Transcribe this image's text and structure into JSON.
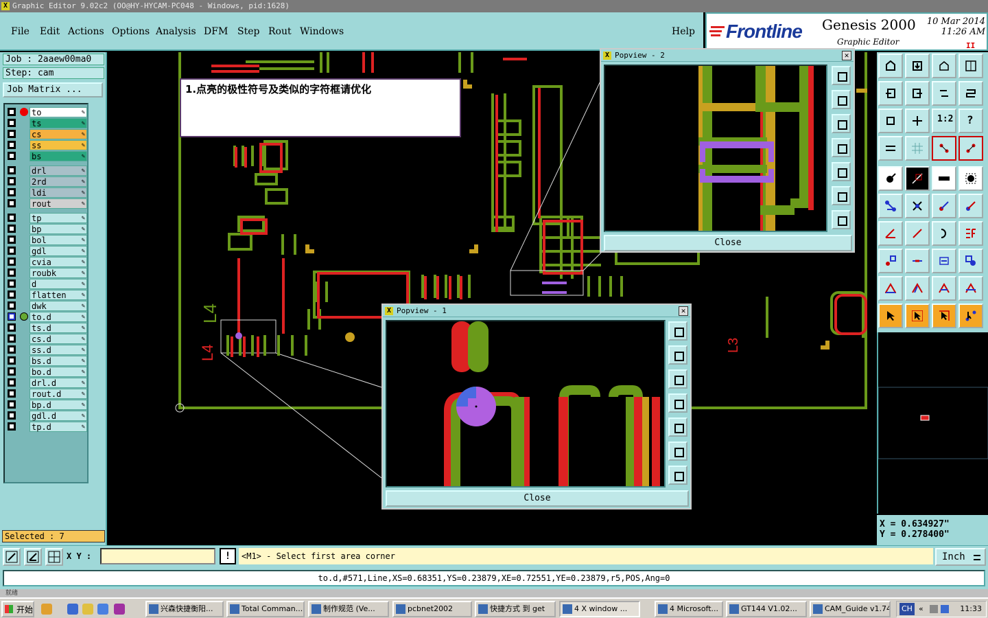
{
  "app": {
    "title": "Graphic Editor 9.02c2 (OO@HY-HYCAM-PC048 - Windows, pid:1628)",
    "title_icon": "x-icon"
  },
  "menu": {
    "items": [
      {
        "label": "File"
      },
      {
        "label": "Edit"
      },
      {
        "label": "Actions"
      },
      {
        "label": "Options"
      },
      {
        "label": "Analysis"
      },
      {
        "label": "DFM"
      },
      {
        "label": "Step"
      },
      {
        "label": "Rout"
      },
      {
        "label": "Windows"
      }
    ],
    "help": "Help"
  },
  "banner": {
    "logo": "Frontline",
    "product": "Genesis 2000",
    "subtitle": "Graphic Editor",
    "date": "10 Mar 2014",
    "time": "11:26 AM",
    "pause_glyph": "II"
  },
  "job": {
    "job_label": "Job : 2aaew00ma0",
    "step_label": "Step: cam",
    "matrix_button": "Job Matrix ..."
  },
  "layers": [
    {
      "name": "to",
      "color": "#ffffff",
      "active": true
    },
    {
      "name": "ts",
      "color": "#2aa880"
    },
    {
      "name": "cs",
      "color": "#f5b040"
    },
    {
      "name": "ss",
      "color": "#f5c040"
    },
    {
      "name": "bs",
      "color": "#2aa880"
    },
    {
      "name": "drl",
      "color": "#a8c0c8",
      "gap": true
    },
    {
      "name": "2rd",
      "color": "#a8c0c8"
    },
    {
      "name": "ldi",
      "color": "#a8c0c8"
    },
    {
      "name": "rout",
      "color": "#d0d0d0"
    },
    {
      "name": "tp",
      "color": "#bfe8e8",
      "gap": true
    },
    {
      "name": "bp",
      "color": "#bfe8e8"
    },
    {
      "name": "bol",
      "color": "#bfe8e8"
    },
    {
      "name": "gdl",
      "color": "#bfe8e8"
    },
    {
      "name": "cvia",
      "color": "#bfe8e8"
    },
    {
      "name": "roubk",
      "color": "#bfe8e8"
    },
    {
      "name": "d",
      "color": "#bfe8e8"
    },
    {
      "name": "flatten",
      "color": "#bfe8e8"
    },
    {
      "name": "dwk",
      "color": "#bfe8e8"
    },
    {
      "name": "to.d",
      "color": "#bfe8e8",
      "work": true
    },
    {
      "name": "ts.d",
      "color": "#bfe8e8"
    },
    {
      "name": "cs.d",
      "color": "#bfe8e8"
    },
    {
      "name": "ss.d",
      "color": "#bfe8e8"
    },
    {
      "name": "bs.d",
      "color": "#bfe8e8"
    },
    {
      "name": "bo.d",
      "color": "#bfe8e8"
    },
    {
      "name": "drl.d",
      "color": "#bfe8e8"
    },
    {
      "name": "rout.d",
      "color": "#bfe8e8"
    },
    {
      "name": "bp.d",
      "color": "#bfe8e8"
    },
    {
      "name": "gdl.d",
      "color": "#bfe8e8"
    },
    {
      "name": "tp.d",
      "color": "#bfe8e8"
    }
  ],
  "selected": "Selected : 7",
  "note": "1.点亮的极性符号及类似的字符框请优化",
  "board_labels": [
    "L4",
    "L4",
    "L3"
  ],
  "popup1": {
    "title": "Popview - 1",
    "close_label": "Close"
  },
  "popup2": {
    "title": "Popview - 2",
    "close_label": "Close"
  },
  "coords": {
    "x": "X = 0.634927\"",
    "y": "Y = 0.278400\""
  },
  "cmd": {
    "xy_label": "X Y :",
    "xy_value": "",
    "excl": "!",
    "prompt": "<M1> - Select first area corner",
    "unit": "Inch"
  },
  "status": "to.d,#571,Line,XS=0.68351,YS=0.23879,XE=0.72551,YE=0.23879,r5,POS,Ang=0",
  "strip": "就绪",
  "taskbar": {
    "start": "开始",
    "tasks": [
      {
        "label": "兴森快捷衡阳..."
      },
      {
        "label": "Total Comman..."
      },
      {
        "label": "制作规范 (Ve..."
      },
      {
        "label": "pcbnet2002"
      },
      {
        "label": "快捷方式 到 get"
      },
      {
        "label": "4 X window ..."
      },
      {
        "label": "4 Microsoft..."
      },
      {
        "label": "GT144 V1.02..."
      },
      {
        "label": "CAM_Guide v1.74"
      }
    ],
    "tray_lang": "CH",
    "clock": "11:33"
  }
}
